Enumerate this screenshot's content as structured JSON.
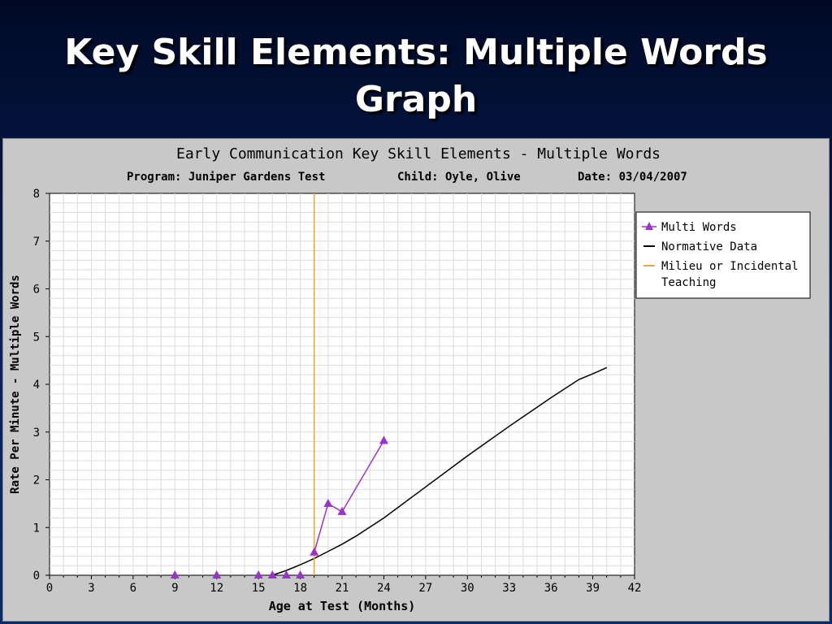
{
  "slide": {
    "title_line1": "Key Skill Elements: Multiple Words",
    "title_line2": "Graph"
  },
  "chart_data": {
    "type": "line",
    "title": "Early Communication Key Skill Elements - Multiple Words",
    "subtitle": {
      "program": "Program: Juniper Gardens Test",
      "child": "Child: Oyle, Olive",
      "date": "Date: 03/04/2007"
    },
    "xlabel": "Age at Test (Months)",
    "ylabel": "Rate Per Minute - Multiple Words",
    "xlim": [
      0,
      42
    ],
    "ylim": [
      0,
      8
    ],
    "x_ticks": [
      0,
      3,
      6,
      9,
      12,
      15,
      18,
      21,
      24,
      27,
      30,
      33,
      36,
      39,
      42
    ],
    "y_ticks": [
      0,
      1,
      2,
      3,
      4,
      5,
      6,
      7,
      8
    ],
    "grid": true,
    "legend_position": "top-right",
    "series": [
      {
        "name": "Multi Words",
        "color": "#9933cc",
        "marker": "triangle",
        "scatter_points": [
          [
            9,
            0
          ],
          [
            12,
            0
          ],
          [
            15,
            0
          ],
          [
            16,
            0
          ],
          [
            17,
            0
          ],
          [
            18,
            0
          ]
        ],
        "line_points": [
          [
            19,
            0.48
          ],
          [
            20,
            1.5
          ],
          [
            21,
            1.33
          ],
          [
            24,
            2.82
          ]
        ]
      },
      {
        "name": "Normative Data",
        "color": "#000000",
        "points": [
          [
            16,
            0
          ],
          [
            17,
            0.1
          ],
          [
            18,
            0.22
          ],
          [
            19,
            0.35
          ],
          [
            20,
            0.5
          ],
          [
            21,
            0.65
          ],
          [
            22,
            0.82
          ],
          [
            24,
            1.2
          ],
          [
            27,
            1.85
          ],
          [
            30,
            2.5
          ],
          [
            33,
            3.12
          ],
          [
            36,
            3.72
          ],
          [
            38,
            4.1
          ],
          [
            39,
            4.22
          ],
          [
            40,
            4.35
          ]
        ]
      },
      {
        "name": "Milieu or Incidental Teaching",
        "legend_lines": [
          "Milieu or Incidental",
          "Teaching"
        ],
        "color": "#f5a623",
        "type": "vline",
        "x": 19
      }
    ]
  }
}
